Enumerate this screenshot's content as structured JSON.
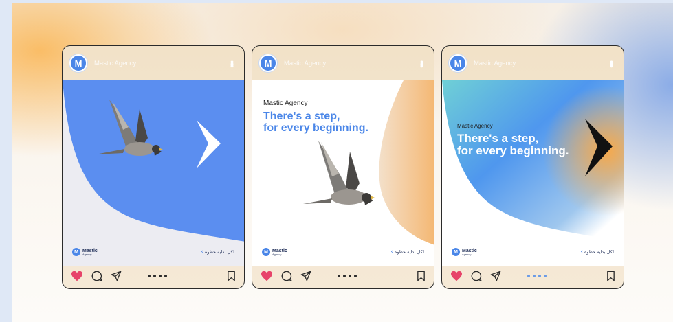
{
  "brand": {
    "account_name": "Mastic Agency",
    "avatar_letter": "M",
    "logo_line1": "Mastic",
    "logo_line2": "Agency",
    "tagline_ar": "لكل بداية خطوة",
    "accent": "#4a86e8",
    "dark": "#1c2b55"
  },
  "cards": [
    {
      "headline_small": "",
      "headline_1": "",
      "headline_2": ""
    },
    {
      "headline_small": "Mastic Agency",
      "headline_1": "There's a step,",
      "headline_2": "for every beginning."
    },
    {
      "headline_small": "Mastic Agency",
      "headline_1": "There's a step,",
      "headline_2": "for every beginning."
    }
  ],
  "icons": {
    "like": "heart-icon",
    "comment": "comment-icon",
    "share": "send-icon",
    "save": "bookmark-icon",
    "more": "more-vertical-icon"
  }
}
